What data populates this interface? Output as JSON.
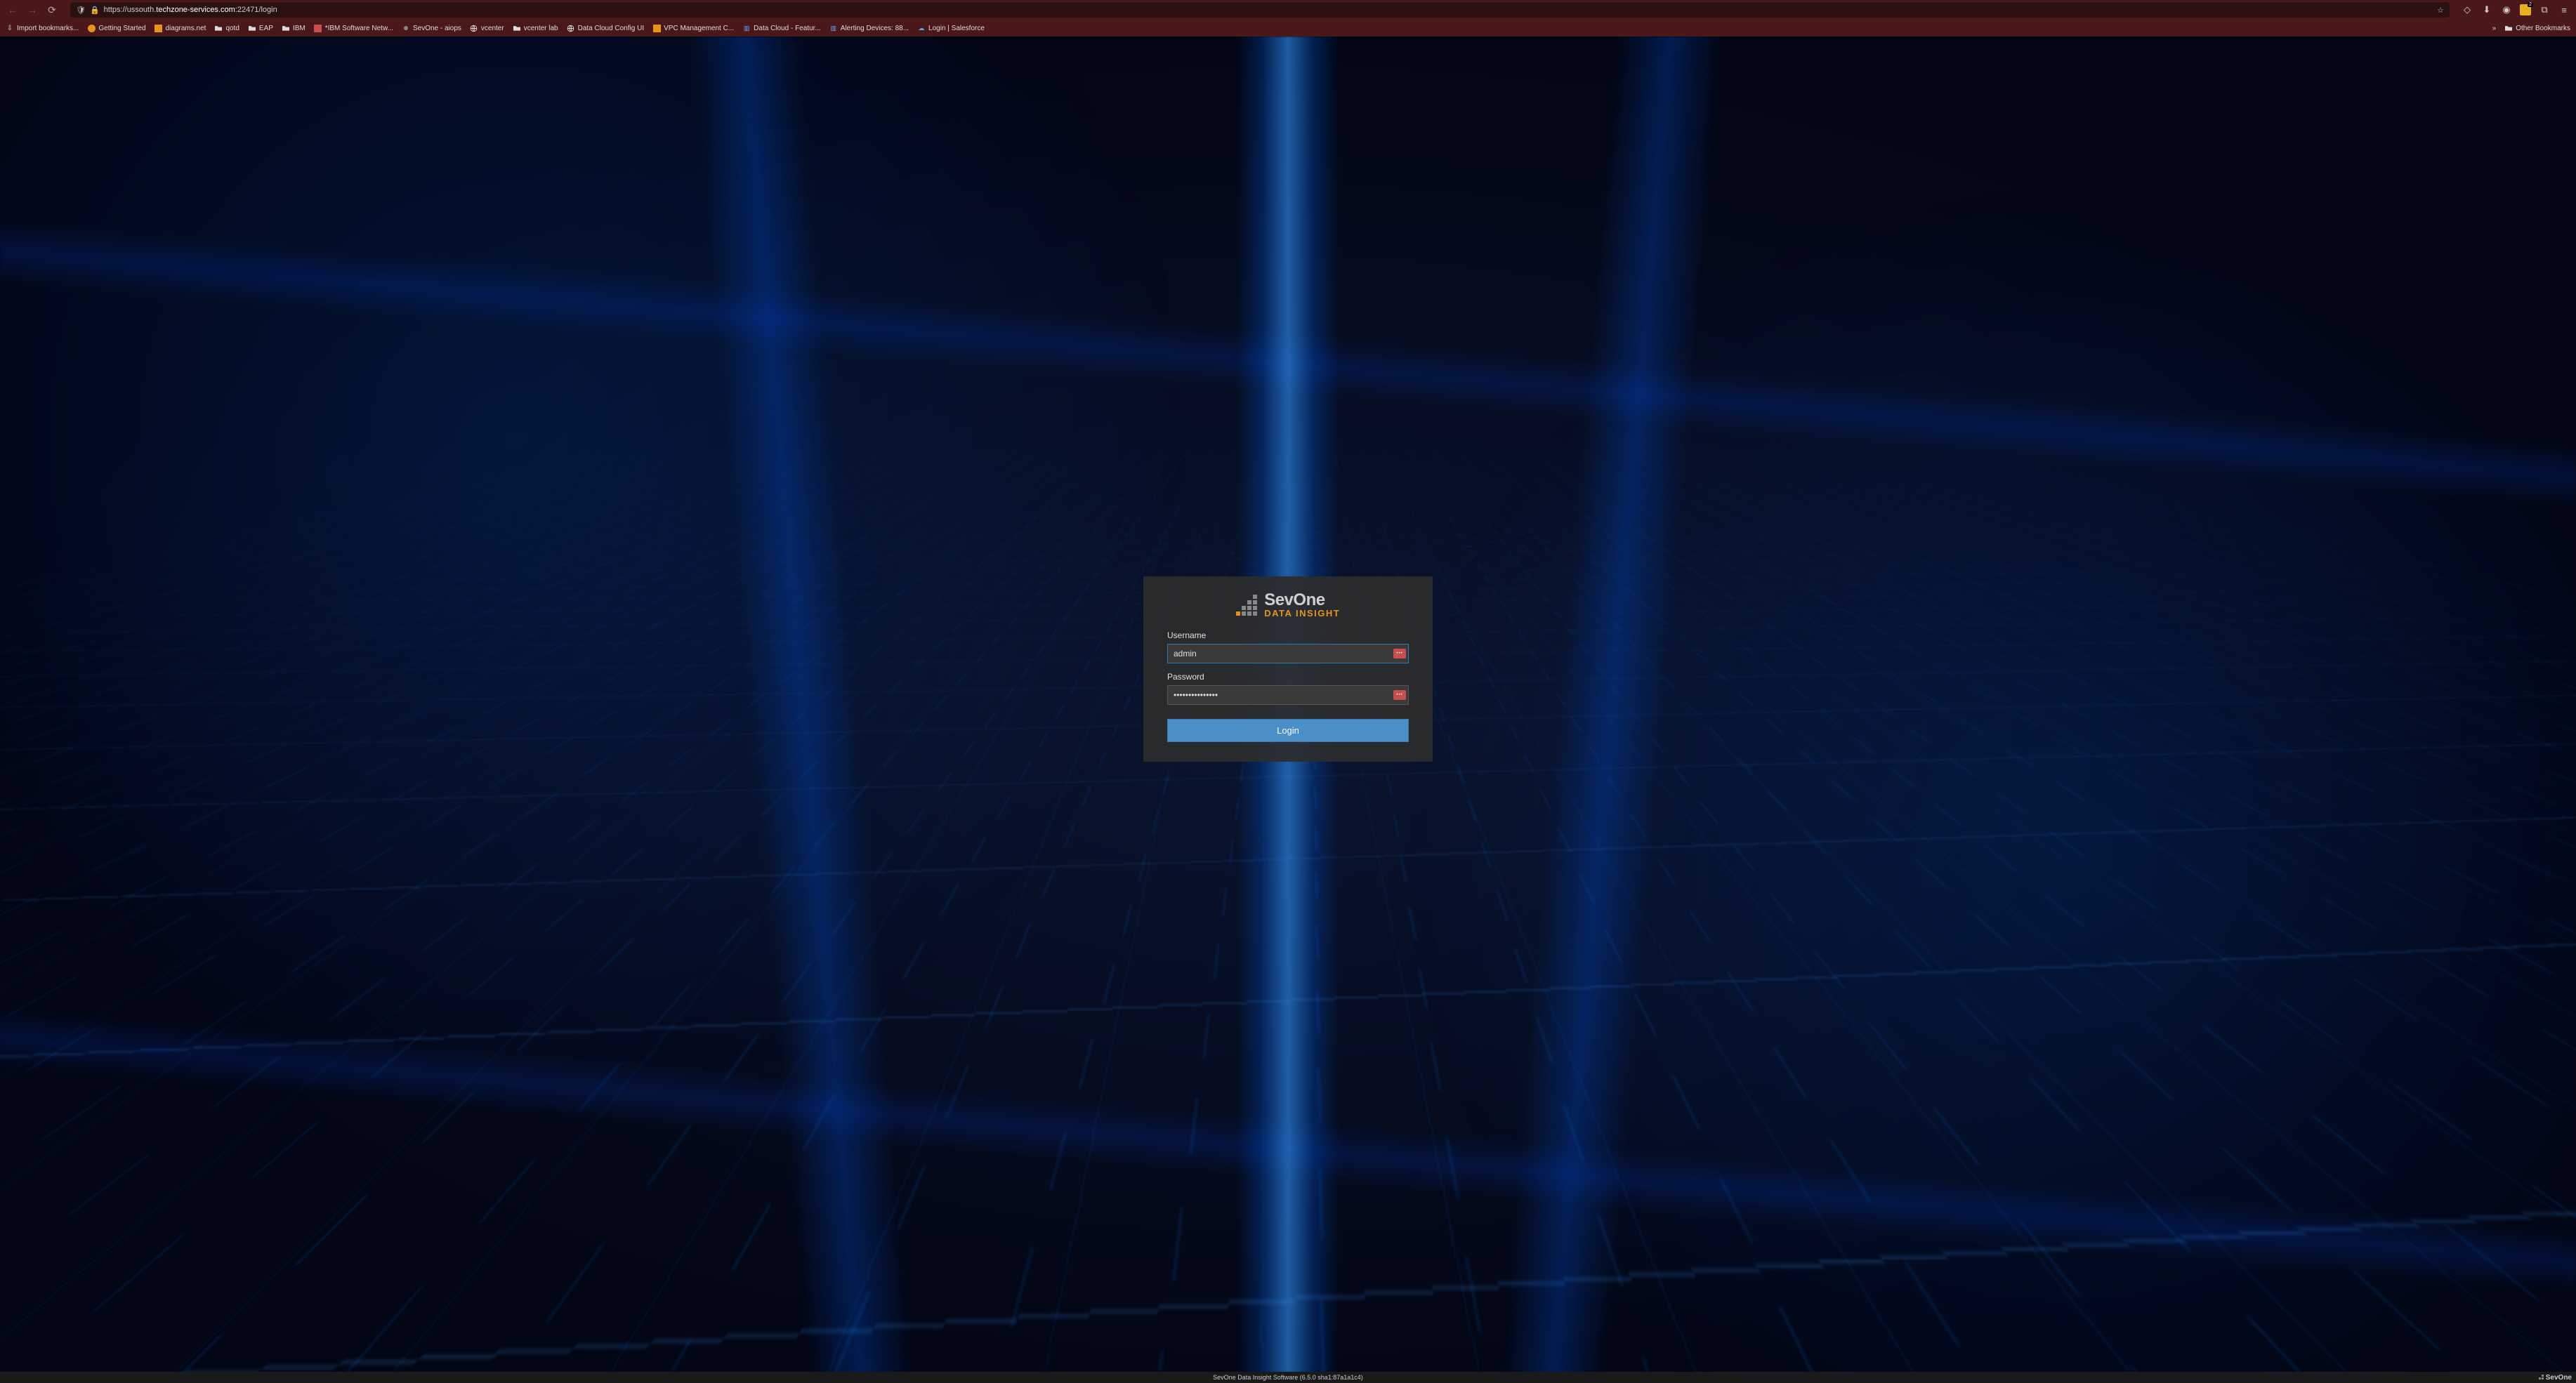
{
  "browser": {
    "url_prefix": "https://ussouth.",
    "url_domain": "techzone-services.com",
    "url_suffix": ":22471/login",
    "toolbar_badge": "2"
  },
  "bookmarks": [
    {
      "label": "Import bookmarks...",
      "icon": "import"
    },
    {
      "label": "Getting Started",
      "icon": "firefox"
    },
    {
      "label": "diagrams.net",
      "icon": "diagrams"
    },
    {
      "label": "qotd",
      "icon": "folder"
    },
    {
      "label": "EAP",
      "icon": "folder"
    },
    {
      "label": "IBM",
      "icon": "folder"
    },
    {
      "label": "*IBM Software Netw...",
      "icon": "box"
    },
    {
      "label": "SevOne - aiops",
      "icon": "dot"
    },
    {
      "label": "vcenter",
      "icon": "globe"
    },
    {
      "label": "vcenter lab",
      "icon": "folder"
    },
    {
      "label": "Data Cloud Config UI",
      "icon": "globe"
    },
    {
      "label": "VPC Management C...",
      "icon": "box-orange"
    },
    {
      "label": "Data Cloud - Featur...",
      "icon": "chart"
    },
    {
      "label": "Alerting Devices: 88...",
      "icon": "chart"
    },
    {
      "label": "Login | Salesforce",
      "icon": "cloud"
    }
  ],
  "bookmarks_other": "Other Bookmarks",
  "login": {
    "logo_main": "SevOne",
    "logo_sub": "DATA INSIGHT",
    "username_label": "Username",
    "username_value": "admin",
    "password_label": "Password",
    "password_value": "•••••••••••••••",
    "button_label": "Login"
  },
  "footer": {
    "text": "SevOne Data Insight Software (6.5.0 sha1:87a1a1c4)",
    "brand": "SevOne"
  }
}
